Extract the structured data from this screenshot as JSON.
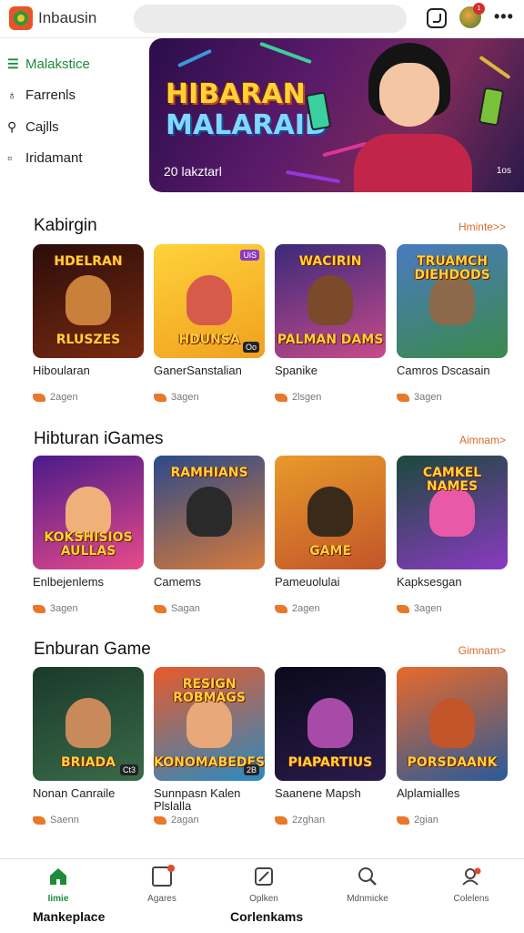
{
  "header": {
    "app_title": "Inbausin",
    "search_placeholder": "",
    "avatar_badge": "1"
  },
  "sidebar": {
    "items": [
      {
        "label": "Malakstice",
        "icon": "store-icon",
        "active": true
      },
      {
        "label": "Farrenls",
        "icon": "bulb-icon",
        "active": false
      },
      {
        "label": "Cajlls",
        "icon": "search-icon",
        "active": false
      },
      {
        "label": "Iridamant",
        "icon": "square-icon",
        "active": false
      }
    ]
  },
  "banner": {
    "title_line1": "HIBARAN",
    "title_line2": "MALARAID",
    "subtitle": "20 lakztarl",
    "tag": "1os"
  },
  "sections": [
    {
      "title": "Kabirgin",
      "more": "Hminte>>",
      "cards": [
        {
          "title": "Hiboularan",
          "meta": "2agen",
          "thumb_top": "HDELRAN",
          "thumb_bottom": "RLUSZES",
          "bg": [
            "#2a0d0a",
            "#7a2a10"
          ],
          "figure": "#c8803a",
          "badge": ""
        },
        {
          "title": "GanerSanstalian",
          "meta": "3agen",
          "thumb_top": "",
          "thumb_bottom": "HDUNSA",
          "bg": [
            "#ffd23a",
            "#f0a020"
          ],
          "figure": "#d85a4a",
          "badge": "Oo",
          "badge_top": "UiS"
        },
        {
          "title": "Spanike",
          "meta": "2lsgen",
          "thumb_top": "WACIRIN",
          "thumb_bottom": "PALMAN DAMS",
          "bg": [
            "#3a2a7a",
            "#c84a8a"
          ],
          "figure": "#7a4a2a",
          "badge": ""
        },
        {
          "title": "Camros Dscasain",
          "meta": "3agen",
          "thumb_top": "TRUAMCH DIEHDODS",
          "thumb_bottom": "",
          "bg": [
            "#4a7ac2",
            "#3a8a4a"
          ],
          "figure": "#8a6a4a",
          "badge": ""
        }
      ]
    },
    {
      "title": "Hibturan iGames",
      "more": "Aimnam>",
      "cards": [
        {
          "title": "Enlbejenlems",
          "meta": "3agen",
          "thumb_top": "",
          "thumb_bottom": "KOKSHISIOS AULLAS",
          "bg": [
            "#4a1a8a",
            "#e84a8a"
          ],
          "figure": "#f0b07a",
          "badge": ""
        },
        {
          "title": "Camems",
          "meta": "Sagan",
          "thumb_top": "RAMHIANS",
          "thumb_bottom": "",
          "bg": [
            "#2a4a8a",
            "#d87a3a"
          ],
          "figure": "#2a2a2a",
          "badge": ""
        },
        {
          "title": "Pameuolulai",
          "meta": "2agen",
          "thumb_top": "",
          "thumb_bottom": "GAME",
          "bg": [
            "#e89a2a",
            "#c2552a"
          ],
          "figure": "#3a2a1a",
          "badge": ""
        },
        {
          "title": "Kapksesgan",
          "meta": "3agen",
          "thumb_top": "CAMKEL NAMES",
          "thumb_bottom": "",
          "bg": [
            "#1a4a3a",
            "#8a3ac2"
          ],
          "figure": "#e85aa8",
          "badge": ""
        }
      ]
    },
    {
      "title": "Enburan Game",
      "more": "Gimnam>",
      "cards": [
        {
          "title": "Nonan Canraile",
          "meta": "Saenn",
          "thumb_top": "",
          "thumb_bottom": "BRIADA",
          "bg": [
            "#1a3a2a",
            "#3a6a4a"
          ],
          "figure": "#c88a5a",
          "badge": "Ct3"
        },
        {
          "title": "Sunnpasn Kalen Plslalla",
          "meta": "2agan",
          "thumb_top": "RESIGN ROBMAGS",
          "thumb_bottom": "KONOMABEDES",
          "bg": [
            "#e85a2a",
            "#2a8ac2"
          ],
          "figure": "#e8a87a",
          "badge": "2B"
        },
        {
          "title": "Saanene Mapsh",
          "meta": "2zghan",
          "thumb_top": "",
          "thumb_bottom": "PIAPARTIUS",
          "bg": [
            "#0a0a1a",
            "#2a1a4a"
          ],
          "figure": "#a84aa8",
          "badge": ""
        },
        {
          "title": "Alplamialles",
          "meta": "2gian",
          "thumb_top": "",
          "thumb_bottom": "PORSDAANK",
          "bg": [
            "#e86a2a",
            "#2a5a9a"
          ],
          "figure": "#c2552a",
          "badge": ""
        }
      ]
    }
  ],
  "bottom_nav": {
    "items": [
      {
        "label": "Iimie",
        "icon": "home-icon",
        "active": true
      },
      {
        "label": "Agares",
        "icon": "image-icon",
        "active": false
      },
      {
        "label": "Oplken",
        "icon": "edit-icon",
        "active": false
      },
      {
        "label": "Mdnmicke",
        "icon": "search-icon",
        "active": false
      },
      {
        "label": "Colelens",
        "icon": "profile-icon",
        "active": false
      }
    ],
    "footer_left": "Mankeplace",
    "footer_center": "Corlenkams"
  },
  "colors": {
    "accent": "#1e8a3a",
    "link": "#d86a2a"
  }
}
